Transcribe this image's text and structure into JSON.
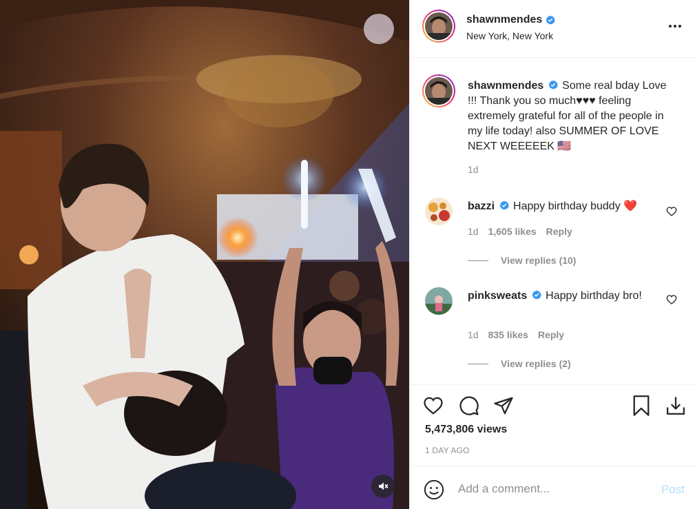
{
  "post": {
    "username": "shawnmendes",
    "location": "New York, New York",
    "more_icon": "more-horizontal-icon"
  },
  "caption": {
    "username": "shawnmendes",
    "text": "Some real bday Love !!! Thank you so much♥♥♥ feeling extremely grateful for all of the people in my life today! also SUMMER OF LOVE NEXT WEEEEEK 🇺🇸",
    "time": "1d"
  },
  "comments": [
    {
      "username": "bazzi",
      "text": "Happy birthday buddy",
      "emoji": "❤️",
      "time": "1d",
      "likes": "1,605 likes",
      "reply": "Reply",
      "view_replies": "View replies (10)"
    },
    {
      "username": "pinksweats",
      "text": "Happy birthday bro!",
      "time": "1d",
      "likes": "835 likes",
      "reply": "Reply",
      "view_replies": "View replies (2)"
    }
  ],
  "stats": {
    "views": "5,473,806 views",
    "time_ago": "1 DAY AGO"
  },
  "composer": {
    "placeholder": "Add a comment...",
    "post_label": "Post"
  },
  "colors": {
    "verified": "#3897f0",
    "heart_red": "#ed4956",
    "post_disabled": "#b2dffc"
  },
  "icons": {
    "like": "heart-icon",
    "comment": "comment-icon",
    "share": "paper-plane-icon",
    "save": "bookmark-icon",
    "download": "download-icon",
    "emoji": "smiley-icon",
    "mute": "muted-speaker-icon"
  }
}
